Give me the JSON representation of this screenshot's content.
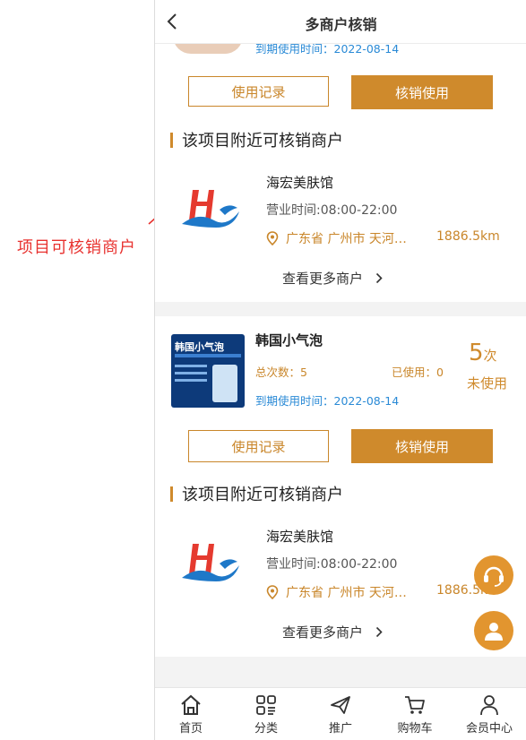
{
  "annotation": {
    "label": "项目可核销商户"
  },
  "header": {
    "title": "多商户核销"
  },
  "product_top": {
    "expiry": "到期使用时间：2022-08-14"
  },
  "buttons": {
    "records": "使用记录",
    "redeem": "核销使用"
  },
  "section_title": "该项目附近可核销商户",
  "merchant": {
    "name": "海宏美肤馆",
    "hours": "营业时间:08:00-22:00",
    "location": "广东省 广州市 天河…",
    "distance": "1886.5km"
  },
  "more_label": "查看更多商户",
  "product": {
    "name": "韩国小气泡",
    "total": "总次数：5",
    "used": "已使用：0",
    "expiry": "到期使用时间：2022-08-14",
    "remaining_num": "5",
    "remaining_unit": "次",
    "status": "未使用"
  },
  "tabbar": [
    {
      "label": "首页",
      "icon": "home-icon"
    },
    {
      "label": "分类",
      "icon": "category-icon"
    },
    {
      "label": "推广",
      "icon": "send-icon"
    },
    {
      "label": "购物车",
      "icon": "cart-icon"
    },
    {
      "label": "会员中心",
      "icon": "user-icon"
    }
  ],
  "colors": {
    "accent": "#cf8a2c",
    "annotation": "#e8322f",
    "link_blue": "#2a8ad6"
  }
}
